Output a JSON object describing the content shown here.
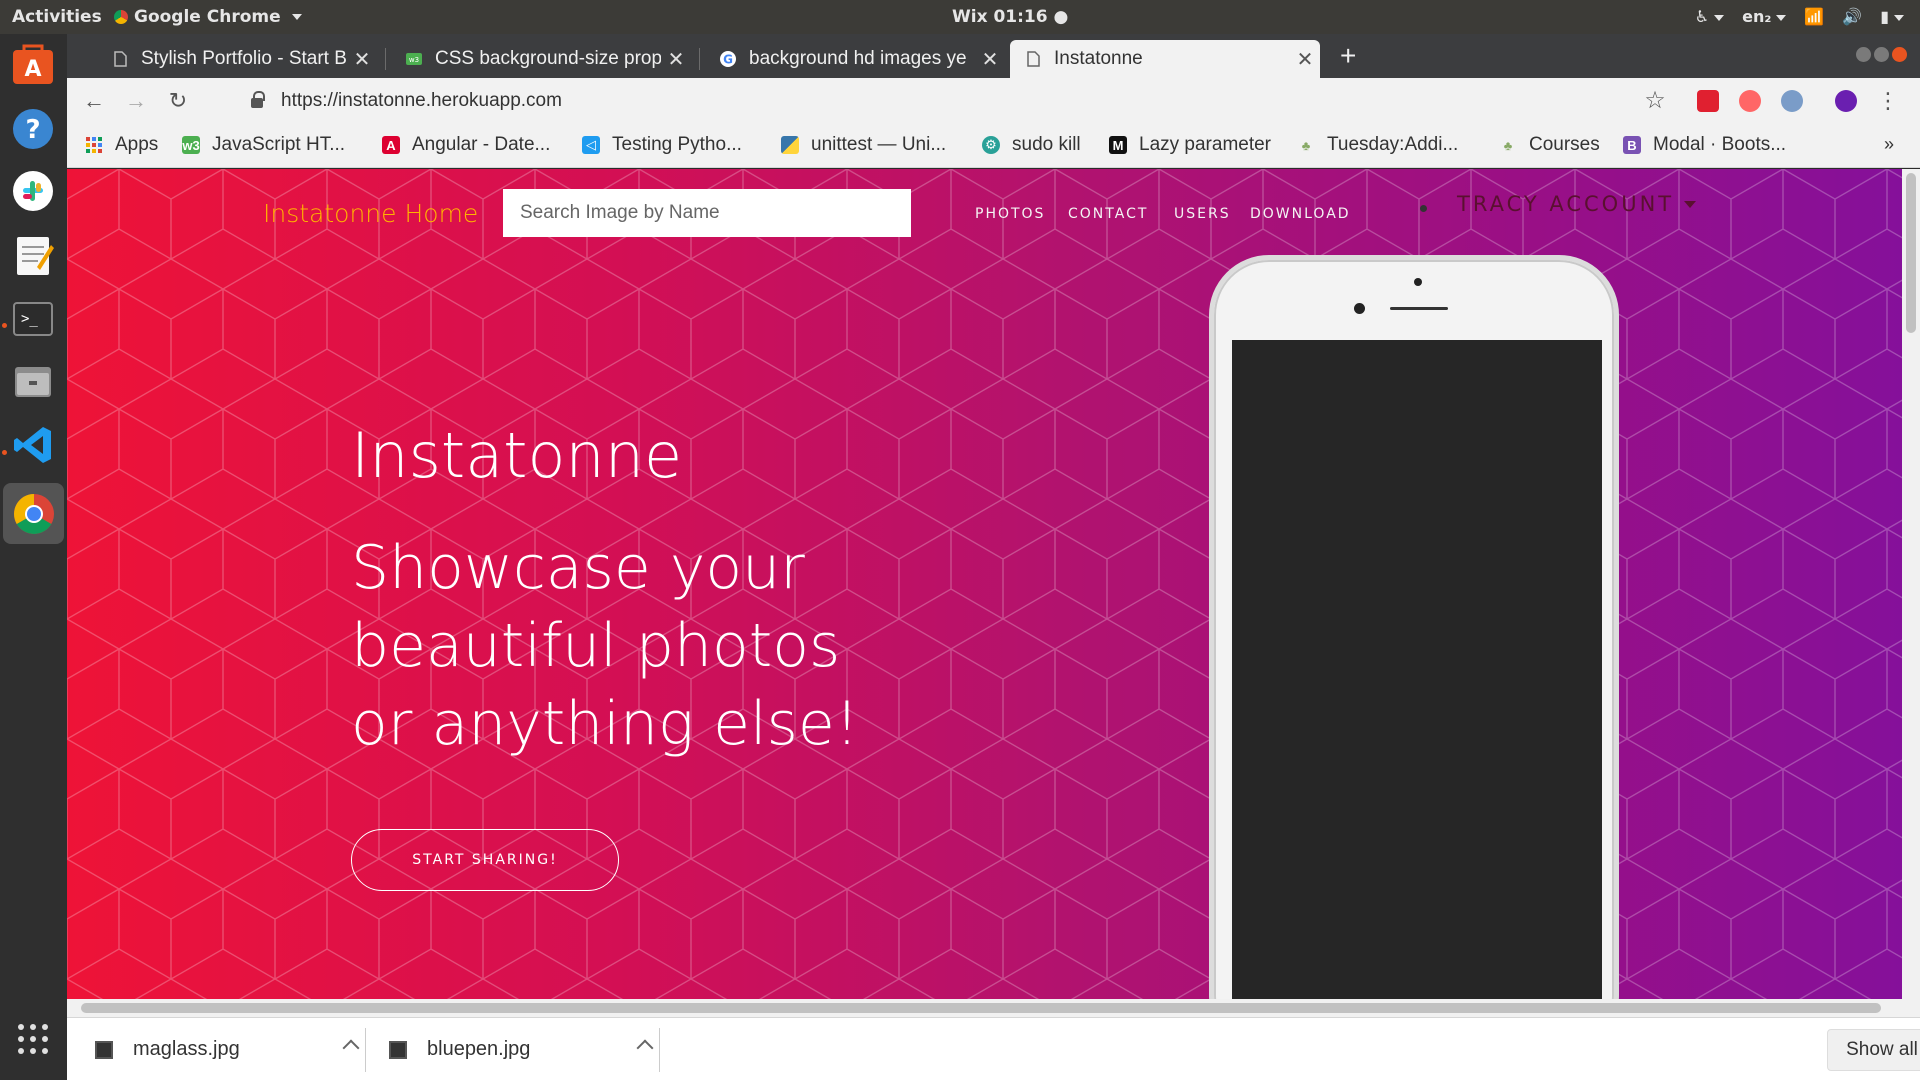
{
  "topbar": {
    "activities": "Activities",
    "app_name": "Google Chrome",
    "clock": "Wix 01:16",
    "language": "en₂"
  },
  "dock": {
    "items": [
      "ubuntu-software-icon",
      "help-icon",
      "slack-icon",
      "text-editor-icon",
      "terminal-icon",
      "file-manager-icon",
      "vscode-icon",
      "chrome-icon",
      "show-apps-icon"
    ]
  },
  "browser": {
    "tabs": [
      {
        "title": "Stylish Portfolio - Start Bo",
        "favicon": "page-icon"
      },
      {
        "title": "CSS background-size prop",
        "favicon": "w3schools-icon"
      },
      {
        "title": "background hd images ye",
        "favicon": "google-icon"
      },
      {
        "title": "Instatonne",
        "favicon": "page-icon",
        "active": true
      }
    ],
    "url": "https://instatonne.herokuapp.com",
    "bookmarks": [
      {
        "label": "Apps",
        "icon": "apps-grid-icon"
      },
      {
        "label": "JavaScript HT...",
        "icon": "w3schools-icon"
      },
      {
        "label": "Angular - Date...",
        "icon": "angular-icon"
      },
      {
        "label": "Testing Pytho...",
        "icon": "vscode-icon"
      },
      {
        "label": "unittest — Uni...",
        "icon": "python-icon"
      },
      {
        "label": "sudo kill",
        "icon": "gear-icon"
      },
      {
        "label": "Lazy parameter",
        "icon": "medium-icon"
      },
      {
        "label": "Tuesday:Addi...",
        "icon": "plant-icon"
      },
      {
        "label": "Courses",
        "icon": "plant-icon"
      },
      {
        "label": "Modal · Boots...",
        "icon": "bootstrap-icon"
      }
    ]
  },
  "site": {
    "brand": "Instatonne Home",
    "search_placeholder": "Search Image by Name",
    "nav": [
      "PHOTOS",
      "CONTACT",
      "USERS",
      "DOWNLOAD"
    ],
    "account": "TRACY ACCOUNT",
    "hero_title": "Instatonne",
    "hero_subtitle": "Showcase your beautiful photos or anything else!",
    "cta": "START SHARING!",
    "colors": {
      "brand": "#ffb400",
      "gradient_start": "#ee1337",
      "gradient_end": "#85109a"
    }
  },
  "downloads": {
    "files": [
      "maglass.jpg",
      "bluepen.jpg"
    ],
    "show_all": "Show all"
  }
}
